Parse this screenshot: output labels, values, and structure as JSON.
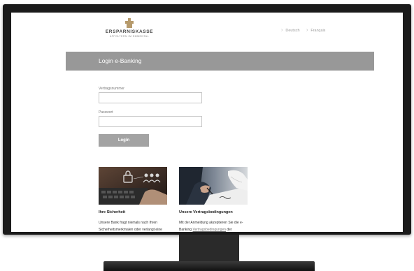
{
  "brand": {
    "name": "ERSPARNISKASSE",
    "subtitle": "AFFOLTERN IM EMMENTAL"
  },
  "languages": [
    {
      "label": "Deutsch"
    },
    {
      "label": "Français"
    }
  ],
  "header": {
    "title": "Login e-Banking"
  },
  "form": {
    "contract_label": "Vertragsnummer",
    "contract_value": "",
    "password_label": "Passwort",
    "password_value": "",
    "login_button": "Login"
  },
  "cards": [
    {
      "title": "Ihre Sicherheit",
      "text_line1": "Unsere Bank fragt niemals nach Ihren",
      "text_line2": "Sicherheitsmerkmalen oder verlangt eine"
    },
    {
      "title": "Unsere Vertragsbedingungen",
      "text_line1": "Mit der Anmeldung akzeptieren Sie die e-",
      "text_line2_prefix": "Banking ",
      "text_line2_link": "Vertragsbedingungen",
      "text_line2_suffix": " der"
    }
  ],
  "colors": {
    "banner": "#989898",
    "button": "#a3a3a3",
    "logo_gold": "#b69a6c"
  }
}
